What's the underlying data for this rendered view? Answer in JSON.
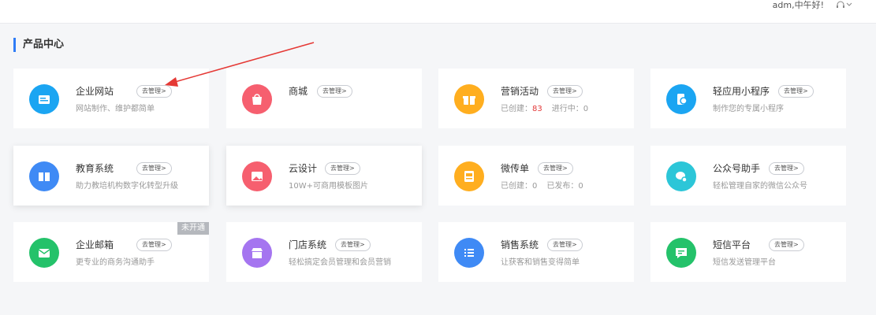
{
  "header": {
    "greeting": "adm,中午好!",
    "icons": [
      "headset-icon",
      "chevron-down-icon"
    ]
  },
  "section": {
    "title": "产品中心"
  },
  "manage_label": "去管理>",
  "colors": {
    "accent": "#2f7cf6",
    "count_red": "#e33a3a",
    "annotation_arrow": "#e53935"
  },
  "products": [
    {
      "name": "企业网站",
      "desc": "网站制作、维护都简单",
      "icon": "website-icon",
      "color": "#1ba5f2"
    },
    {
      "name": "商城",
      "desc": "",
      "icon": "shop-bag-icon",
      "color": "#f65f6f"
    },
    {
      "name": "营销活动",
      "stats": [
        {
          "label": "已创建：",
          "value": "83"
        },
        {
          "label": "进行中：",
          "value": "0"
        }
      ],
      "icon": "gift-icon",
      "color": "#ffae1f"
    },
    {
      "name": "轻应用小程序",
      "desc": "制作您的专属小程序",
      "icon": "mini-program-icon",
      "color": "#1ba5f2"
    },
    {
      "name": "教育系统",
      "desc": "助力教培机构数字化转型升级",
      "icon": "book-icon",
      "color": "#3f8af5"
    },
    {
      "name": "云设计",
      "desc": "10W+可商用模板图片",
      "icon": "image-icon",
      "color": "#f65f6f"
    },
    {
      "name": "微传单",
      "stats": [
        {
          "label": "已创建：",
          "value": "0"
        },
        {
          "label": "已发布：",
          "value": "0"
        }
      ],
      "icon": "flyer-icon",
      "color": "#ffae1f"
    },
    {
      "name": "公众号助手",
      "desc": "轻松管理自家的微信公众号",
      "icon": "chat-gear-icon",
      "color": "#2cc6d8"
    },
    {
      "name": "企业邮箱",
      "desc": "更专业的商务沟通助手",
      "icon": "mail-icon",
      "color": "#24c26a",
      "tag": "未开通"
    },
    {
      "name": "门店系统",
      "desc": "轻松搞定会员管理和会员营销",
      "icon": "store-icon",
      "color": "#a575f0"
    },
    {
      "name": "销售系统",
      "desc": "让获客和销售变得简单",
      "icon": "list-icon",
      "color": "#3f8af5"
    },
    {
      "name": "短信平台",
      "desc": "短信发送管理平台",
      "icon": "message-icon",
      "color": "#24c26a"
    }
  ]
}
